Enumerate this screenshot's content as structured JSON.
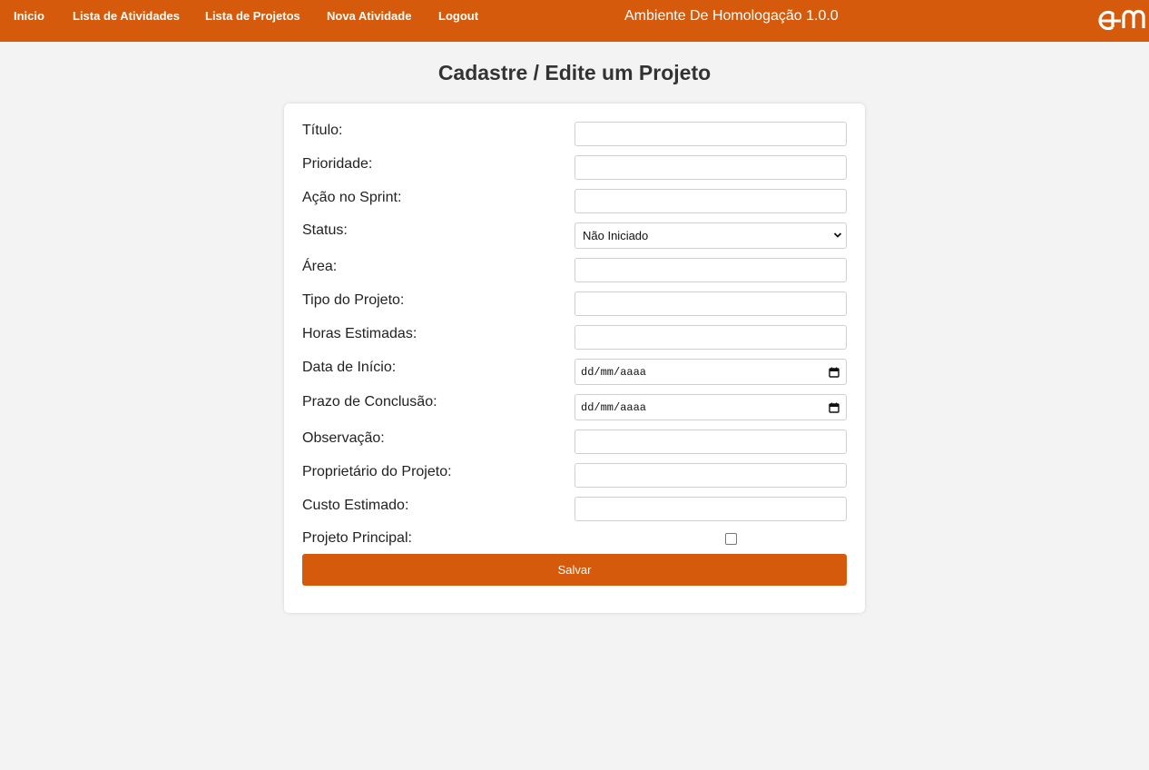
{
  "navbar": {
    "links": [
      "Inicio",
      "Lista de Atividades",
      "Lista de Projetos",
      "Nova Atividade",
      "Logout"
    ],
    "environment_title": "Ambiente De Homologação 1.0.0",
    "logo_icon": "am-logo-icon",
    "background_color": "#d55a0c"
  },
  "page": {
    "title": "Cadastre / Edite um Projeto"
  },
  "form": {
    "titulo_label": "Título:",
    "titulo_value": "",
    "prioridade_label": "Prioridade:",
    "prioridade_value": "",
    "acao_sprint_label": "Ação no Sprint:",
    "acao_sprint_value": "",
    "status_label": "Status:",
    "status_selected": "Não Iniciado",
    "area_label": "Área:",
    "area_value": "",
    "tipo_label": "Tipo do Projeto:",
    "tipo_value": "",
    "horas_label": "Horas Estimadas:",
    "horas_value": "",
    "data_inicio_label": "Data de Início:",
    "data_inicio_placeholder": "dd/mm/aaaa",
    "prazo_label": "Prazo de Conclusão:",
    "prazo_placeholder": "dd/mm/aaaa",
    "observacao_label": "Observação:",
    "observacao_value": "",
    "proprietario_label": "Proprietário do Projeto:",
    "proprietario_value": "",
    "custo_label": "Custo Estimado:",
    "custo_value": "",
    "principal_label": "Projeto Principal:",
    "principal_checked": false,
    "save_label": "Salvar"
  }
}
